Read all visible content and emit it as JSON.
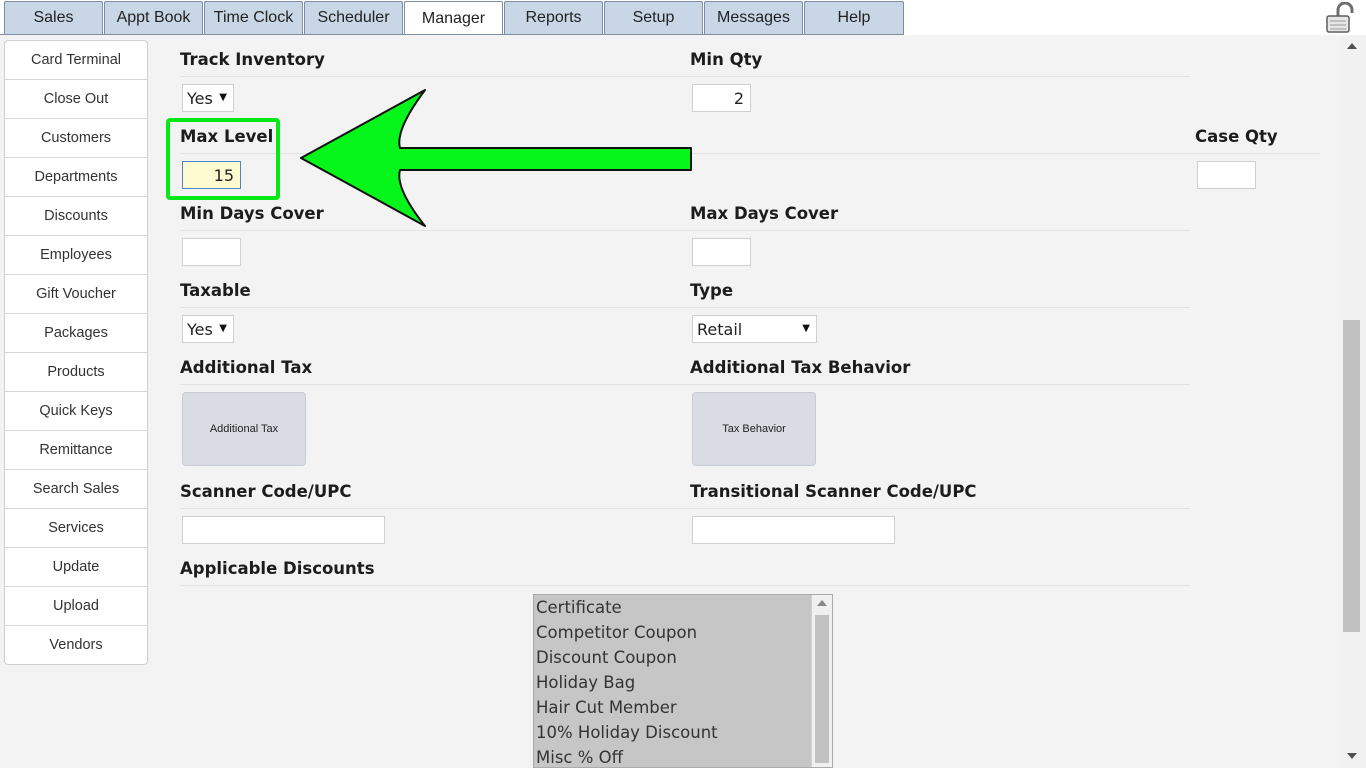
{
  "tabs": [
    {
      "label": "Sales",
      "active": false
    },
    {
      "label": "Appt Book",
      "active": false
    },
    {
      "label": "Time Clock",
      "active": false
    },
    {
      "label": "Scheduler",
      "active": false
    },
    {
      "label": "Manager",
      "active": true
    },
    {
      "label": "Reports",
      "active": false
    },
    {
      "label": "Setup",
      "active": false
    },
    {
      "label": "Messages",
      "active": false
    },
    {
      "label": "Help",
      "active": false
    }
  ],
  "sidebar": {
    "items": [
      {
        "label": "Card Terminal"
      },
      {
        "label": "Close Out"
      },
      {
        "label": "Customers"
      },
      {
        "label": "Departments"
      },
      {
        "label": "Discounts"
      },
      {
        "label": "Employees"
      },
      {
        "label": "Gift Voucher"
      },
      {
        "label": "Packages"
      },
      {
        "label": "Products"
      },
      {
        "label": "Quick Keys"
      },
      {
        "label": "Remittance"
      },
      {
        "label": "Search Sales"
      },
      {
        "label": "Services"
      },
      {
        "label": "Update"
      },
      {
        "label": "Upload"
      },
      {
        "label": "Vendors"
      }
    ]
  },
  "form": {
    "track_inventory": {
      "label": "Track Inventory",
      "value": "Yes"
    },
    "min_qty": {
      "label": "Min Qty",
      "value": "2"
    },
    "max_level": {
      "label": "Max Level",
      "value": "15"
    },
    "case_qty": {
      "label": "Case Qty",
      "value": ""
    },
    "min_days_cover": {
      "label": "Min Days Cover",
      "value": ""
    },
    "max_days_cover": {
      "label": "Max Days Cover",
      "value": ""
    },
    "taxable": {
      "label": "Taxable",
      "value": "Yes"
    },
    "type": {
      "label": "Type",
      "value": "Retail"
    },
    "additional_tax": {
      "label": "Additional Tax",
      "button_label": "Additional Tax"
    },
    "additional_tax_behavior": {
      "label": "Additional Tax Behavior",
      "button_label": "Tax Behavior"
    },
    "scanner_code": {
      "label": "Scanner Code/UPC",
      "value": ""
    },
    "transitional_scanner_code": {
      "label": "Transitional Scanner Code/UPC",
      "value": ""
    },
    "applicable_discounts": {
      "label": "Applicable Discounts",
      "options": [
        "Certificate",
        "Competitor Coupon",
        "Discount Coupon",
        "Holiday Bag",
        "Hair Cut Member",
        "10% Holiday Discount",
        "Misc % Off"
      ]
    }
  },
  "colors": {
    "highlight": "#06e817",
    "tab_background": "#c8d6e6",
    "panel_background": "#f3f3f3",
    "list_background": "#c6c6c6",
    "focused_input": "#fffbd0"
  },
  "icons": {
    "lock": "unlocked-padlock-icon",
    "arrow": "green-arrow-left-icon"
  }
}
